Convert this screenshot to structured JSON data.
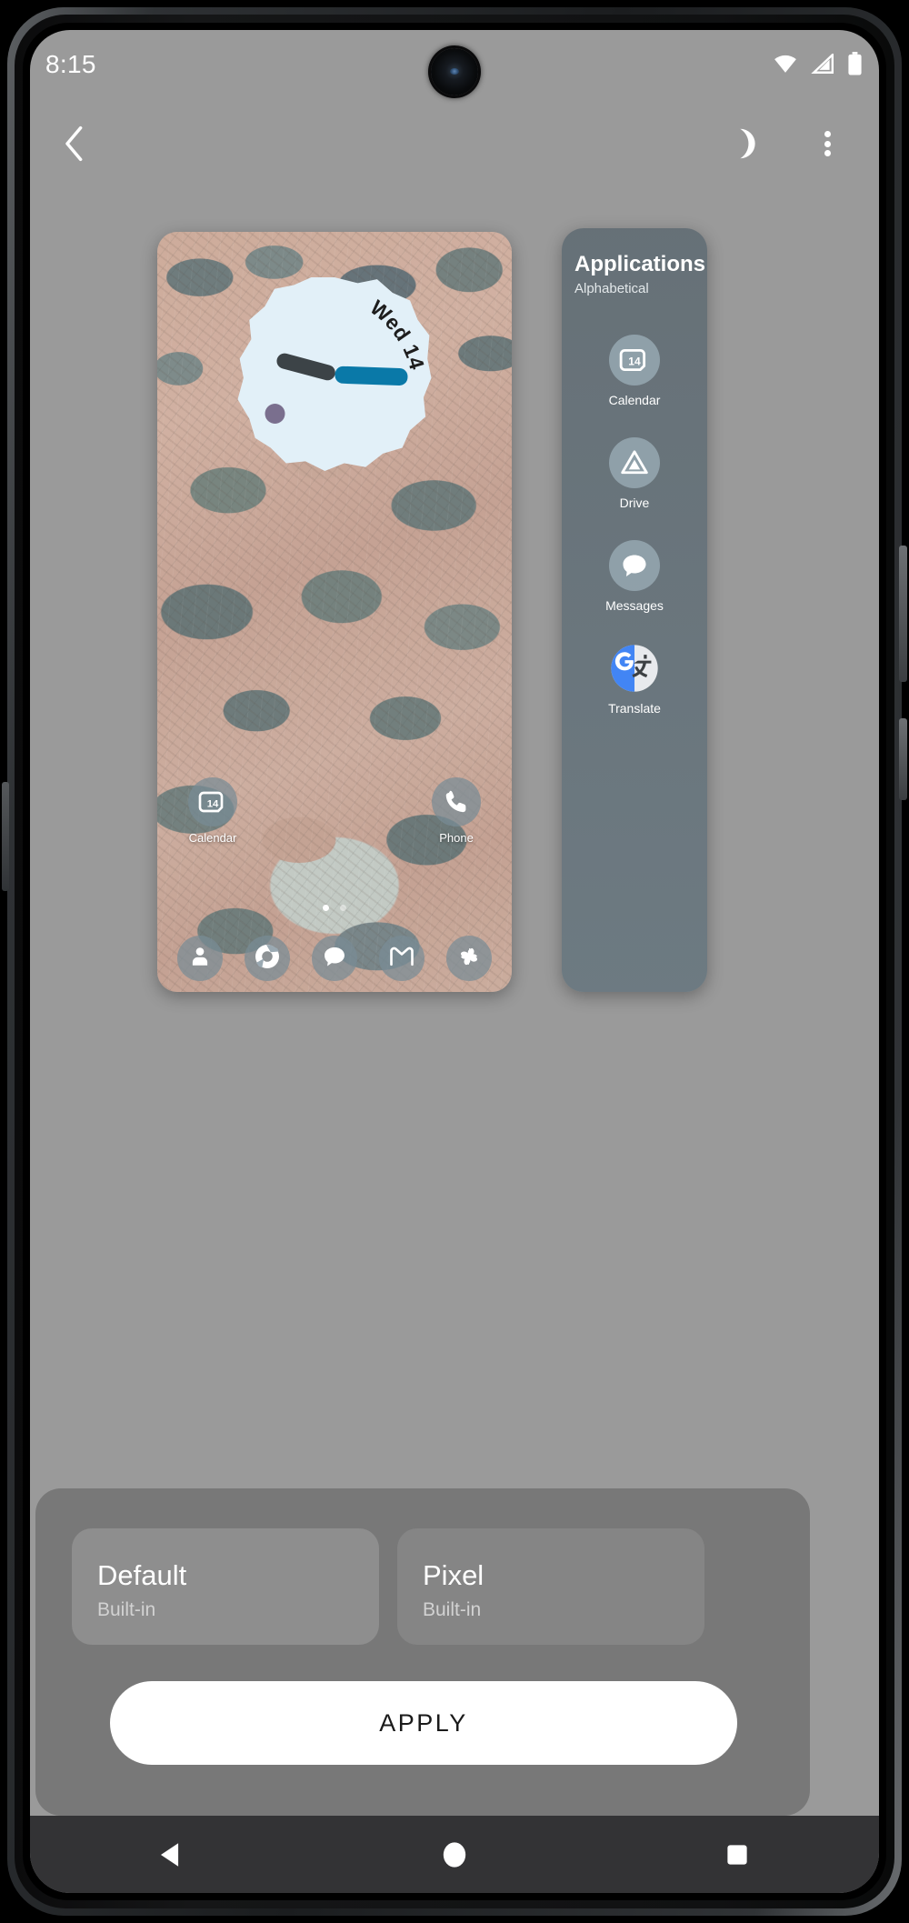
{
  "status_bar": {
    "time": "8:15",
    "icons": [
      "wifi-icon",
      "cellular-signal-icon",
      "battery-icon"
    ]
  },
  "toolbar": {
    "back_icon": "chevron-left-icon",
    "dark_mode_icon": "moon-icon",
    "overflow_icon": "more-vertical-icon"
  },
  "preview": {
    "clock_widget": {
      "date_text": "Wed 14",
      "hour_hand_color": "#3c4347",
      "minute_hand_color": "#0a79a8",
      "face_color": "#e2f0f8",
      "dot_color": "#7a6f8e"
    },
    "home_icons": [
      {
        "label": "Calendar",
        "icon": "calendar-icon",
        "badge": "14"
      },
      {
        "label": "Phone",
        "icon": "phone-icon"
      }
    ],
    "page_dots": {
      "count": 2,
      "active_index": 0
    },
    "dock": [
      {
        "label": "Contacts",
        "icon": "contacts-icon"
      },
      {
        "label": "Chrome",
        "icon": "chrome-icon"
      },
      {
        "label": "Messages",
        "icon": "messages-icon"
      },
      {
        "label": "Gmail",
        "icon": "gmail-icon"
      },
      {
        "label": "Photos",
        "icon": "photos-icon"
      }
    ]
  },
  "apps_panel": {
    "title": "Applications",
    "subtitle": "Alphabetical",
    "items": [
      {
        "label": "Calendar",
        "icon": "calendar-icon",
        "badge": "14"
      },
      {
        "label": "Drive",
        "icon": "drive-icon"
      },
      {
        "label": "Messages",
        "icon": "messages-icon"
      },
      {
        "label": "Translate",
        "icon": "translate-icon"
      }
    ]
  },
  "bottom_sheet": {
    "options": [
      {
        "title": "Default",
        "subtitle": "Built-in",
        "selected": true
      },
      {
        "title": "Pixel",
        "subtitle": "Built-in",
        "selected": false
      }
    ],
    "apply_label": "APPLY"
  },
  "nav_bar": {
    "back_icon": "nav-back-triangle-icon",
    "home_icon": "nav-home-circle-icon",
    "recents_icon": "nav-recents-square-icon"
  }
}
